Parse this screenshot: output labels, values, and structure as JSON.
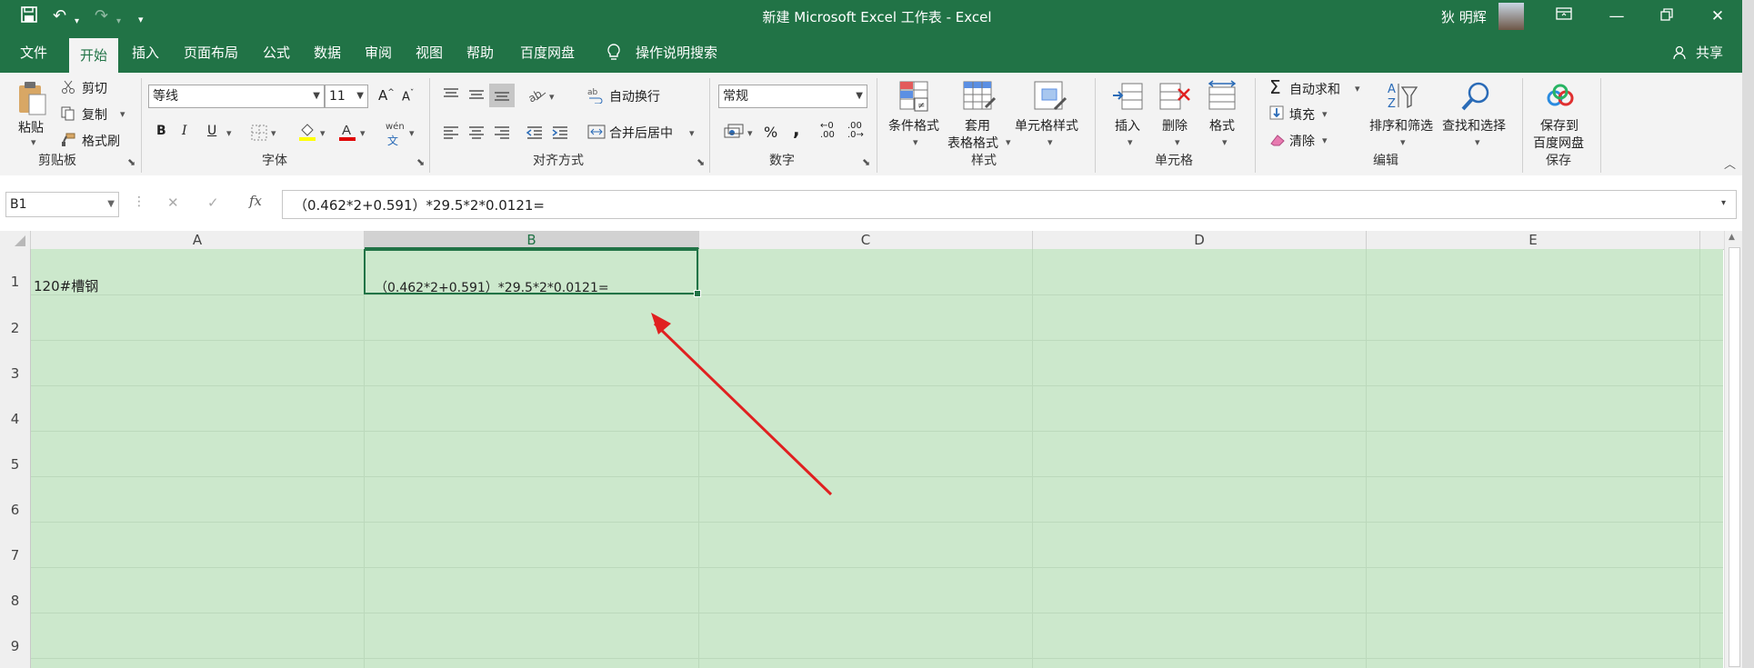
{
  "window": {
    "title": "新建 Microsoft Excel 工作表  -  Excel",
    "user": "狄 明辉",
    "controls": [
      "restore-ribbon",
      "minimize",
      "maximize",
      "close"
    ]
  },
  "qat": {
    "save_icon": "save-icon",
    "undo_icon": "undo-icon",
    "redo_icon": "redo-icon",
    "customize": "▾"
  },
  "tabs": [
    "文件",
    "开始",
    "插入",
    "页面布局",
    "公式",
    "数据",
    "审阅",
    "视图",
    "帮助",
    "百度网盘"
  ],
  "tell_me": "操作说明搜索",
  "share": "共享",
  "ribbon": {
    "clipboard": {
      "paste": "粘贴",
      "cut": "剪切",
      "copy": "复制",
      "format_painter": "格式刷",
      "group": "剪贴板"
    },
    "font": {
      "name": "等线",
      "size": "11",
      "bold": "B",
      "italic": "I",
      "underline": "U",
      "wen": "wén",
      "group": "字体",
      "grow": "A",
      "shrink": "A"
    },
    "alignment": {
      "wrap": "自动换行",
      "merge": "合并后居中",
      "group": "对齐方式"
    },
    "number": {
      "format": "常规",
      "percent": "%",
      "comma": ",",
      "group": "数字",
      "inc": ".00",
      "dec": ".0"
    },
    "styles": {
      "conditional": "条件格式",
      "table_1": "套用",
      "table_2": "表格格式",
      "cell": "单元格样式",
      "group": "样式"
    },
    "cells": {
      "insert": "插入",
      "delete": "删除",
      "format": "格式",
      "group": "单元格"
    },
    "editing": {
      "autosum": "自动求和",
      "fill": "填充",
      "clear": "清除",
      "sort": "排序和筛选",
      "find": "查找和选择",
      "group": "编辑"
    },
    "save": {
      "baidu_1": "保存到",
      "baidu_2": "百度网盘",
      "group": "保存"
    }
  },
  "formula_bar": {
    "name_box": "B1",
    "cancel": "✕",
    "enter": "✓",
    "fx": "fx",
    "formula": "（0.462*2+0.591）*29.5*2*0.0121="
  },
  "columns": [
    "A",
    "B",
    "C",
    "D",
    "E"
  ],
  "rows": [
    "1",
    "2",
    "3",
    "4",
    "5",
    "6",
    "7",
    "8",
    "9"
  ],
  "cells": {
    "A1": "120#槽钢",
    "B1": "（0.462*2+0.591）*29.5*2*0.0121="
  },
  "selected_cell": "B1",
  "colors": {
    "excel_green": "#217346",
    "sheet_fill": "#cce8cc",
    "arrow": "#e02020"
  }
}
